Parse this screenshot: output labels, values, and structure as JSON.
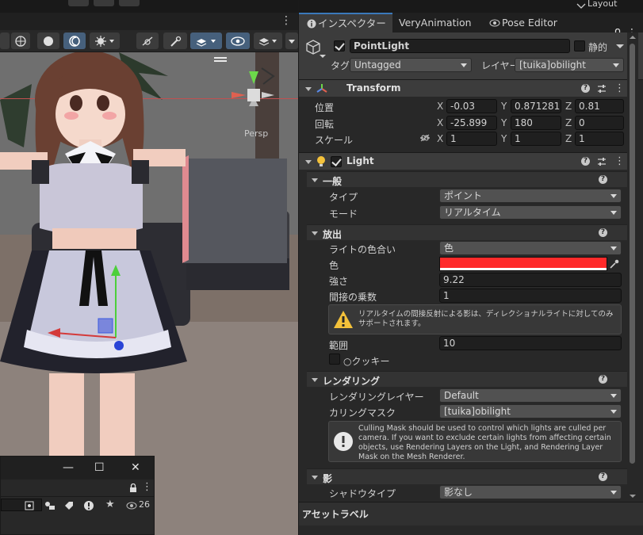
{
  "inspector": {
    "tabs": [
      {
        "label": "インスペクター"
      },
      {
        "label": "VeryAnimation"
      },
      {
        "label": "Pose Editor"
      }
    ],
    "top_label": "Layout"
  },
  "object": {
    "name": "PointLight",
    "static_label": "静的",
    "tag_label": "タグ",
    "tag_value": "Untagged",
    "layer_label": "レイヤー",
    "layer_value": "[tuika]obilight"
  },
  "transform": {
    "title": "Transform",
    "position": {
      "label": "位置",
      "x": "-0.03",
      "y": "0.8712816",
      "z": "0.81"
    },
    "rotation": {
      "label": "回転",
      "x": "-25.899",
      "y": "180",
      "z": "0"
    },
    "scale": {
      "label": "スケール",
      "x": "1",
      "y": "1",
      "z": "1"
    }
  },
  "light": {
    "title": "Light",
    "general": {
      "title": "一般",
      "type_label": "タイプ",
      "type_value": "ポイント",
      "mode_label": "モード",
      "mode_value": "リアルタイム"
    },
    "emission": {
      "title": "放出",
      "appearance_label": "ライトの色合い",
      "appearance_value": "色",
      "color_label": "色",
      "color_hex": "#ff2a2a",
      "intensity_label": "強さ",
      "intensity_value": "9.22",
      "indirect_label": "間接の乗数",
      "indirect_value": "1",
      "warning_text": "リアルタイムの間接反射による影は、ディレクショナルライトに対してのみサポートされます。",
      "range_label": "範囲",
      "range_value": "10",
      "cookie_label": "クッキー"
    },
    "rendering": {
      "title": "レンダリング",
      "layer_label": "レンダリングレイヤー",
      "layer_value": "Default",
      "culling_label": "カリングマスク",
      "culling_value": "[tuika]obilight",
      "info_text": "Culling Mask should be used to control which lights are culled per camera. If you want to exclude certain lights from affecting certain objects, use Rendering Layers on the Light, and Rendering Layer Mask on the Mesh Renderer."
    },
    "shadows": {
      "title": "影",
      "type_label": "シャドウタイプ",
      "type_value": "影なし"
    }
  },
  "asset_label": "アセットラベル",
  "scene": {
    "persp_label": "Persp",
    "visible_count": "26"
  },
  "colors": {
    "accent": "#3a79bb",
    "light_color": "#ff2a2a",
    "panel": "#282828",
    "header": "#3c3c3c"
  }
}
